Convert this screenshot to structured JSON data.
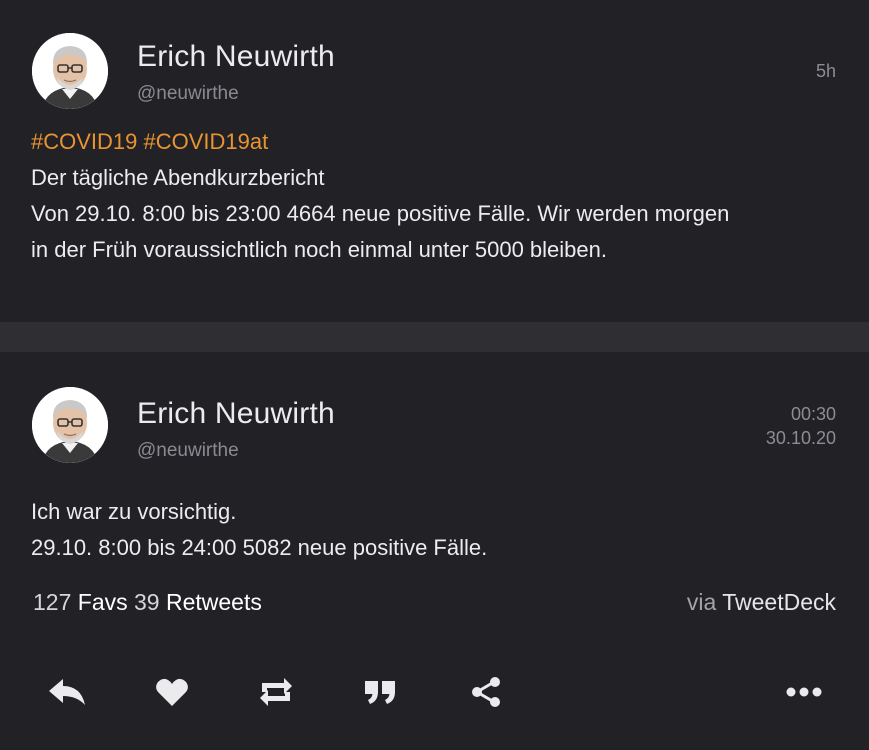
{
  "tweets": [
    {
      "author_name": "Erich Neuwirth",
      "author_handle": "@neuwirthe",
      "time_line1": "5h",
      "time_line2": "",
      "hashtags": "#COVID19 #COVID19at",
      "lines": [
        "Der tägliche Abendkurzbericht",
        "Von 29.10. 8:00 bis 23:00 4664 neue positive Fälle. Wir werden morgen",
        "in der Früh voraussichtlich noch einmal unter 5000 bleiben."
      ]
    },
    {
      "author_name": "Erich Neuwirth",
      "author_handle": "@neuwirthe",
      "time_line1": "00:30",
      "time_line2": "30.10.20",
      "lines": [
        "Ich war zu vorsichtig.",
        "29.10. 8:00 bis 24:00 5082 neue positive Fälle."
      ],
      "stats": {
        "favs_count": "127",
        "favs_label": "Favs",
        "retweets_count": "39",
        "retweets_label": "Retweets"
      },
      "via": {
        "prefix": "via",
        "client": "TweetDeck"
      }
    }
  ],
  "actions": [
    {
      "name": "reply",
      "icon": "reply-icon"
    },
    {
      "name": "favorite",
      "icon": "heart-icon"
    },
    {
      "name": "retweet",
      "icon": "retweet-icon"
    },
    {
      "name": "quote",
      "icon": "quote-icon"
    },
    {
      "name": "share",
      "icon": "share-icon"
    },
    {
      "name": "more",
      "icon": "more-dots-icon"
    }
  ],
  "colors": {
    "background": "#222126",
    "separator": "#2f2e33",
    "hashtag": "#e89433",
    "text": "#ececef",
    "muted": "#8b8a90"
  }
}
